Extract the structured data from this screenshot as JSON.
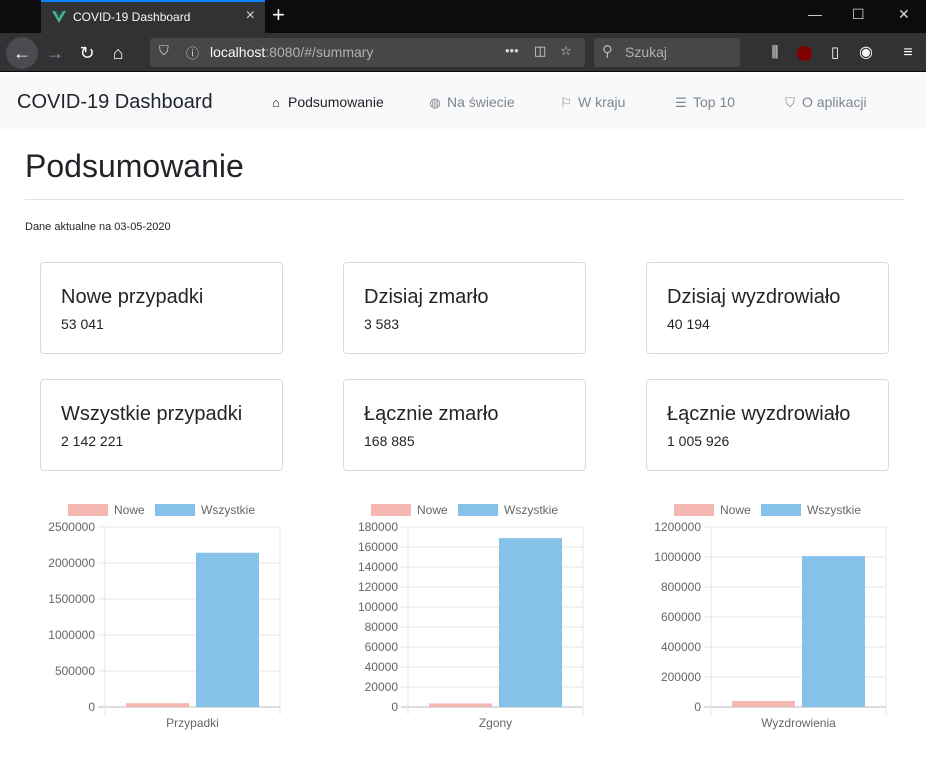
{
  "browser": {
    "tab_title": "COVID-19 Dashboard",
    "url_host": "localhost",
    "url_rest": ":8080/#/summary",
    "search_placeholder": "Szukaj"
  },
  "app": {
    "brand": "COVID-19 Dashboard",
    "nav": [
      {
        "label": "Podsumowanie",
        "icon": "home-icon",
        "active": true
      },
      {
        "label": "Na świecie",
        "icon": "globe-icon",
        "active": false
      },
      {
        "label": "W kraju",
        "icon": "flag-icon",
        "active": false
      },
      {
        "label": "Top 10",
        "icon": "list-icon",
        "active": false
      },
      {
        "label": "O aplikacji",
        "icon": "bookmark-icon",
        "active": false
      }
    ]
  },
  "page": {
    "title": "Podsumowanie",
    "date_line": "Dane aktualne na 03-05-2020"
  },
  "cards": [
    {
      "title": "Nowe przypadki",
      "value": "53 041"
    },
    {
      "title": "Dzisiaj zmarło",
      "value": "3 583"
    },
    {
      "title": "Dzisiaj wyzdrowiało",
      "value": "40 194"
    },
    {
      "title": "Wszystkie przypadki",
      "value": "2 142 221"
    },
    {
      "title": "Łącznie zmarło",
      "value": "168 885"
    },
    {
      "title": "Łącznie wyzdrowiało",
      "value": "1 005 926"
    }
  ],
  "colors": {
    "new_series": "#f5b7b1",
    "total_series": "#85c1e9",
    "active_nav": "#212529",
    "muted_nav": "#80868b"
  },
  "chart_data": [
    {
      "type": "bar",
      "categories": [
        "Przypadki"
      ],
      "series": [
        {
          "name": "Nowe",
          "values": [
            53041
          ]
        },
        {
          "name": "Wszystkie",
          "values": [
            2142221
          ]
        }
      ],
      "ylim": [
        0,
        2500000
      ],
      "yticks": [
        0,
        500000,
        1000000,
        1500000,
        2000000,
        2500000
      ],
      "legend": "top",
      "grid": true
    },
    {
      "type": "bar",
      "categories": [
        "Zgony"
      ],
      "series": [
        {
          "name": "Nowe",
          "values": [
            3583
          ]
        },
        {
          "name": "Wszystkie",
          "values": [
            168885
          ]
        }
      ],
      "ylim": [
        0,
        180000
      ],
      "yticks": [
        0,
        20000,
        40000,
        60000,
        80000,
        100000,
        120000,
        140000,
        160000,
        180000
      ],
      "legend": "top",
      "grid": true
    },
    {
      "type": "bar",
      "categories": [
        "Wyzdrowienia"
      ],
      "series": [
        {
          "name": "Nowe",
          "values": [
            40194
          ]
        },
        {
          "name": "Wszystkie",
          "values": [
            1005926
          ]
        }
      ],
      "ylim": [
        0,
        1200000
      ],
      "yticks": [
        0,
        200000,
        400000,
        600000,
        800000,
        1000000,
        1200000
      ],
      "legend": "top",
      "grid": true
    }
  ]
}
